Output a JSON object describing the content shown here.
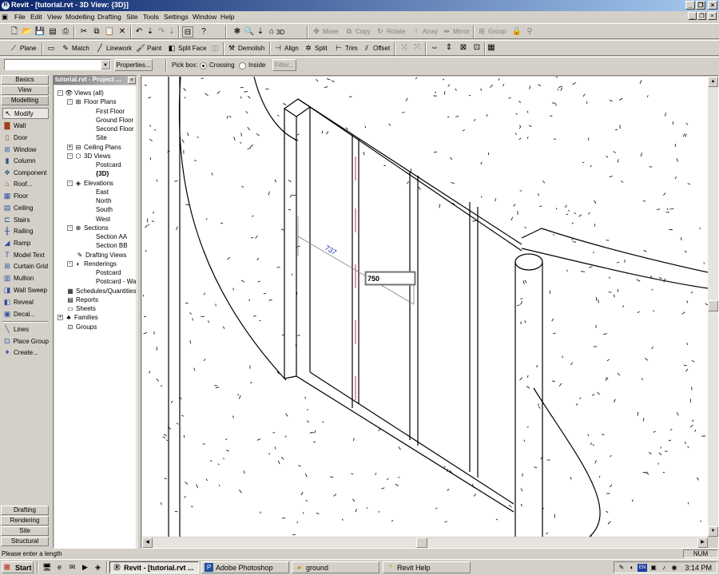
{
  "window": {
    "title": "Revit - [tutorial.rvt - 3D View: {3D}]",
    "app_icon": "revit-icon"
  },
  "menu": [
    "File",
    "Edit",
    "View",
    "Modelling",
    "Drafting",
    "Site",
    "Tools",
    "Settings",
    "Window",
    "Help"
  ],
  "toolbar1": {
    "view3d_label": "3D",
    "move": "Move",
    "copy": "Copy",
    "rotate": "Rotate",
    "array": "Array",
    "mirror": "Mirror",
    "group": "Group"
  },
  "toolbar2": {
    "plane": "Plane",
    "match": "Match",
    "linework": "Linework",
    "paint": "Paint",
    "split_face": "Split Face",
    "demolish": "Demolish",
    "align": "Align",
    "split": "Split",
    "trim": "Trim",
    "offset": "Offset"
  },
  "options": {
    "type_value": "",
    "properties": "Properties...",
    "pick_box": "Pick box:",
    "crossing": "Crossing",
    "inside": "Inside",
    "filter": "Filter..."
  },
  "designbar": {
    "top_tabs": [
      "Basics",
      "View",
      "Modelling"
    ],
    "items": [
      {
        "label": "Modify",
        "icon": "arrow-cursor-icon"
      },
      {
        "label": "Wall",
        "icon": "wall-icon"
      },
      {
        "label": "Door",
        "icon": "door-icon"
      },
      {
        "label": "Window",
        "icon": "window-icon"
      },
      {
        "label": "Column",
        "icon": "column-icon"
      },
      {
        "label": "Component",
        "icon": "component-icon"
      },
      {
        "label": "Roof...",
        "icon": "roof-icon"
      },
      {
        "label": "Floor",
        "icon": "floor-icon"
      },
      {
        "label": "Ceiling",
        "icon": "ceiling-icon"
      },
      {
        "label": "Stairs",
        "icon": "stairs-icon"
      },
      {
        "label": "Railing",
        "icon": "railing-icon"
      },
      {
        "label": "Ramp",
        "icon": "ramp-icon"
      },
      {
        "label": "Model Text",
        "icon": "model-text-icon"
      },
      {
        "label": "Curtain Grid",
        "icon": "curtain-grid-icon"
      },
      {
        "label": "Mullion",
        "icon": "mullion-icon"
      },
      {
        "label": "Wall Sweep",
        "icon": "wall-sweep-icon"
      },
      {
        "label": "Reveal",
        "icon": "reveal-icon"
      },
      {
        "label": "Decal...",
        "icon": "decal-icon"
      },
      {
        "label": "Lines",
        "icon": "lines-icon"
      },
      {
        "label": "Place Group",
        "icon": "place-group-icon"
      },
      {
        "label": "Create...",
        "icon": "create-icon"
      }
    ],
    "bottom_tabs": [
      "Drafting",
      "Rendering",
      "Site",
      "Structural"
    ]
  },
  "browser": {
    "title": "tutorial.rvt - Project ...",
    "tree": [
      {
        "label": "Views (all)",
        "level": 0,
        "exp": "-",
        "icon": "eye-icon"
      },
      {
        "label": "Floor Plans",
        "level": 1,
        "exp": "-",
        "icon": "floor-plan-icon"
      },
      {
        "label": "First Floor",
        "level": 2
      },
      {
        "label": "Ground Floor",
        "level": 2
      },
      {
        "label": "Second Floor",
        "level": 2
      },
      {
        "label": "Site",
        "level": 2
      },
      {
        "label": "Ceiling Plans",
        "level": 1,
        "exp": "+",
        "icon": "ceiling-plan-icon"
      },
      {
        "label": "3D Views",
        "level": 1,
        "exp": "-",
        "icon": "cube-icon"
      },
      {
        "label": "Postcard",
        "level": 2
      },
      {
        "label": "{3D}",
        "level": 2,
        "selected": true
      },
      {
        "label": "Elevations",
        "level": 1,
        "exp": "-",
        "icon": "elevation-icon"
      },
      {
        "label": "East",
        "level": 2
      },
      {
        "label": "North",
        "level": 2
      },
      {
        "label": "South",
        "level": 2
      },
      {
        "label": "West",
        "level": 2
      },
      {
        "label": "Sections",
        "level": 1,
        "exp": "-",
        "icon": "section-icon"
      },
      {
        "label": "Section AA",
        "level": 2
      },
      {
        "label": "Section BB",
        "level": 2
      },
      {
        "label": "Drafting Views",
        "level": 1,
        "icon": "drafting-view-icon"
      },
      {
        "label": "Renderings",
        "level": 1,
        "exp": "-",
        "icon": "rendering-icon"
      },
      {
        "label": "Postcard",
        "level": 2
      },
      {
        "label": "Postcard - Wall",
        "level": 2
      },
      {
        "label": "Schedules/Quantities",
        "level": 0,
        "icon": "schedule-icon"
      },
      {
        "label": "Reports",
        "level": 0,
        "icon": "report-icon"
      },
      {
        "label": "Sheets",
        "level": 0,
        "icon": "sheet-icon"
      },
      {
        "label": "Families",
        "level": 0,
        "exp": "+",
        "icon": "family-icon"
      },
      {
        "label": "Groups",
        "level": 0,
        "icon": "group-icon"
      }
    ]
  },
  "viewport": {
    "dimension_label": "737",
    "dimension_input": "750"
  },
  "status": {
    "text": "Please enter a length",
    "num": "NUM"
  },
  "taskbar": {
    "start": "Start",
    "tasks": [
      {
        "label": "Revit - [tutorial.rvt ...",
        "icon": "revit-icon",
        "active": true
      },
      {
        "label": "Adobe Photoshop",
        "icon": "photoshop-icon"
      },
      {
        "label": "ground",
        "icon": "folder-icon"
      },
      {
        "label": "Revit Help",
        "icon": "help-icon"
      }
    ],
    "language": "EN",
    "clock": "3:14 PM"
  }
}
